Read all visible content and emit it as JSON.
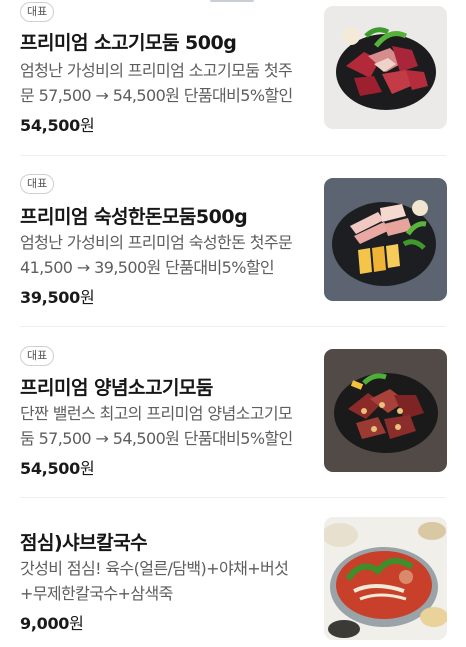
{
  "menu": {
    "items": [
      {
        "badge": "대표",
        "name": "프리미엄 소고기모둠 500g",
        "description": "엄청난 가성비의 프리미엄 소고기모둠 첫주문 57,500 → 54,500원 단품대비5%할인",
        "price": "54,500",
        "currency": "원",
        "image_icon": "beef-platter-photo"
      },
      {
        "badge": "대표",
        "name": "프리미엄 숙성한돈모둠500g",
        "description": "엄청난 가성비의 프리미엄 숙성한돈 첫주문 41,500 → 39,500원 단품대비5%할인",
        "price": "39,500",
        "currency": "원",
        "image_icon": "pork-platter-photo"
      },
      {
        "badge": "대표",
        "name": "프리미엄 양념소고기모둠",
        "description": "단짠 밸런스 최고의 프리미엄 양념소고기모둠 57,500 → 54,500원 단품대비5%할인",
        "price": "54,500",
        "currency": "원",
        "image_icon": "marinated-beef-platter-photo"
      },
      {
        "badge": "",
        "name": "점심)샤브칼국수",
        "description": "갓성비 점심! 육수(얼른/담백)+야채+버섯+무제한칼국수+삼색죽",
        "price": "9,000",
        "currency": "원",
        "image_icon": "shabu-kalguksu-photo"
      }
    ]
  }
}
